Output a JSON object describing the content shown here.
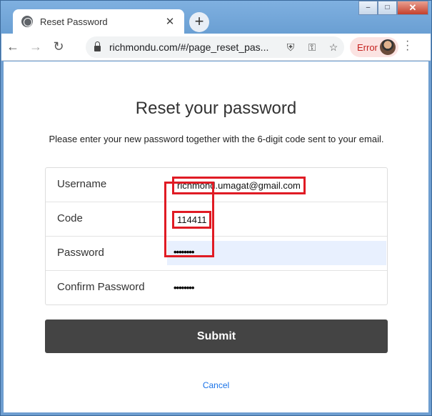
{
  "browser": {
    "tab_title": "Reset Password",
    "tab_close": "✕",
    "new_tab": "+",
    "url": "richmondu.com/#/page_reset_pas...",
    "error_label": "Error",
    "win_min": "‒",
    "win_max": "□",
    "win_close": "✕"
  },
  "page": {
    "title": "Reset your password",
    "description": "Please enter your new password together with the 6-digit code sent to your email.",
    "fields": [
      {
        "label": "Username",
        "value": "richmond.umagat@gmail.com"
      },
      {
        "label": "Code",
        "value": "114411"
      },
      {
        "label": "Password",
        "value": "••••••••"
      },
      {
        "label": "Confirm Password",
        "value": "••••••••"
      }
    ],
    "submit_label": "Submit",
    "cancel_label": "Cancel"
  }
}
